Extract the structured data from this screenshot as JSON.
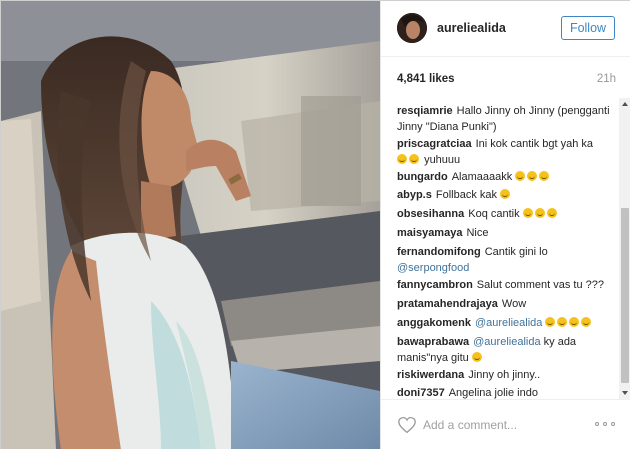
{
  "post": {
    "username": "aureliealida",
    "follow_label": "Follow",
    "likes": "4,841 likes",
    "time": "21h",
    "add_comment_placeholder": "Add a comment...",
    "accent_color": "#3f87c4",
    "mention_color": "#3f729b"
  },
  "comments": [
    {
      "user": "resqiamrie",
      "text": "Hallo Jinny oh Jinny (pengganti Jinny \"Diana Punki\")"
    },
    {
      "user": "priscagratciaa",
      "text": "Ini kok cantik bgt yah ka",
      "emoji_after": 2,
      "text2": "yuhuuu"
    },
    {
      "user": "bungardo",
      "text": "Alamaaaakk",
      "emoji_after": 3
    },
    {
      "user": "abyp.s",
      "text": "Follback kak",
      "emoji_after": 1
    },
    {
      "user": "obsesihanna",
      "text": "Koq cantik",
      "emoji_after": 3
    },
    {
      "user": "maisyamaya",
      "text": "Nice"
    },
    {
      "user": "fernandomifong",
      "text": "Cantik gini lo",
      "mention": "@serpongfood"
    },
    {
      "user": "fannycambron",
      "text": "Salut comment vas tu ???"
    },
    {
      "user": "pratamahendrajaya",
      "text": "Wow"
    },
    {
      "user": "anggakomenk",
      "mention": "@aureliealida",
      "emoji_after": 4
    },
    {
      "user": "bawaprabawa",
      "mention": "@aureliealida",
      "text": "ky ada manis\"nya gitu",
      "emoji_after": 1
    },
    {
      "user": "riskiwerdana",
      "text": "Jinny oh jinny.."
    },
    {
      "user": "doni7357",
      "text": "Angelina jolie indo"
    }
  ],
  "icons": {
    "heart": "heart-icon",
    "more": "more-options-icon",
    "scroll_up": "scroll-up-arrow-icon",
    "scroll_down": "scroll-down-arrow-icon"
  }
}
